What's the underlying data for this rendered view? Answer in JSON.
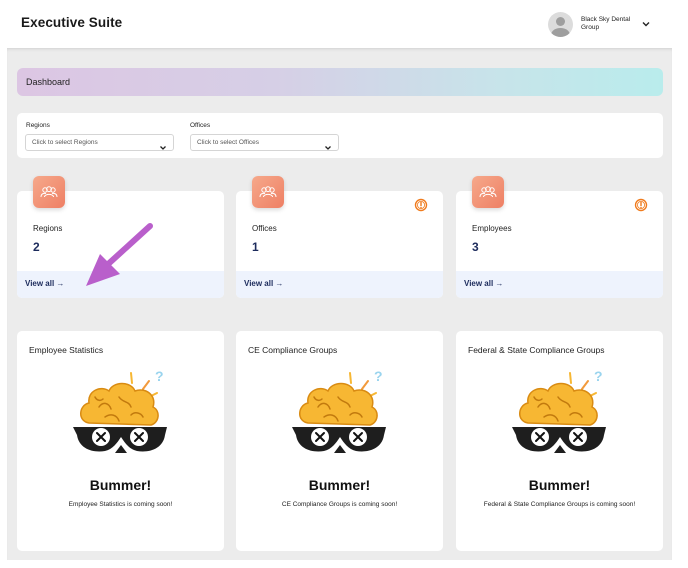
{
  "app": {
    "title": "Executive Suite"
  },
  "user": {
    "org_name": "Black Sky Dental Group"
  },
  "banner": {
    "title": "Dashboard"
  },
  "filters": {
    "regions": {
      "label": "Regions",
      "placeholder": "Click to select Regions"
    },
    "offices": {
      "label": "Offices",
      "placeholder": "Click to select Offices"
    }
  },
  "stats": [
    {
      "label": "Regions",
      "value": "2",
      "link": "View all →",
      "icon": "people-icon",
      "alert": false
    },
    {
      "label": "Offices",
      "value": "1",
      "link": "View all →",
      "icon": "people-icon",
      "alert": true
    },
    {
      "label": "Employees",
      "value": "3",
      "link": "View all →",
      "icon": "people-icon",
      "alert": true
    }
  ],
  "panels": [
    {
      "title": "Employee Statistics",
      "heading": "Bummer!",
      "message": "Employee Statistics is coming soon!"
    },
    {
      "title": "CE Compliance Groups",
      "heading": "Bummer!",
      "message": "CE Compliance Groups is coming soon!"
    },
    {
      "title": "Federal & State Compliance Groups",
      "heading": "Bummer!",
      "message": "Federal & State Compliance Groups is coming soon!"
    }
  ],
  "colors": {
    "accent_navy": "#1c2b5c",
    "icon_orange": "#ee7f64",
    "alert_orange": "#f07b1d",
    "annotation_purple": "#b95fcb",
    "brain_yellow": "#f7b733"
  }
}
